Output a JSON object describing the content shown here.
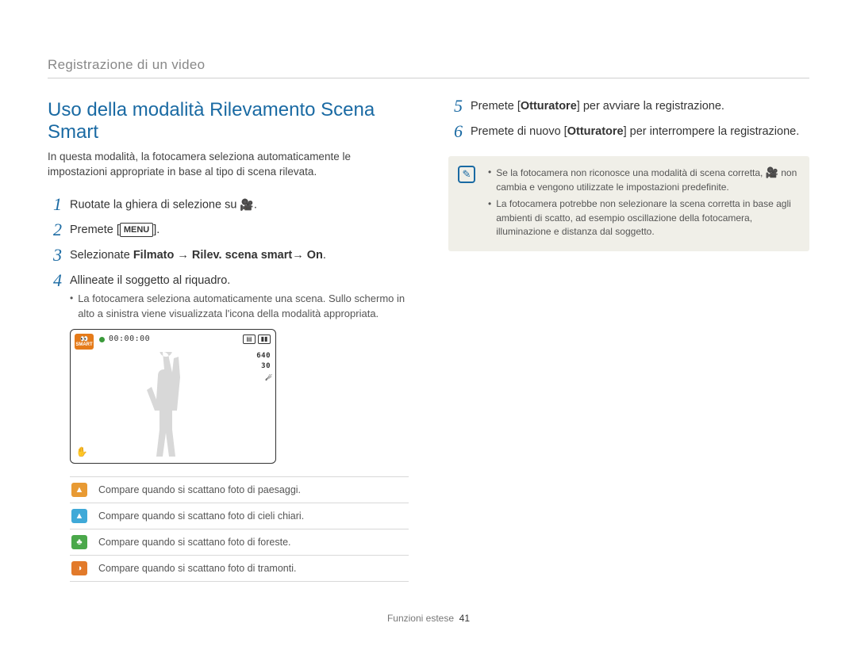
{
  "header": {
    "section": "Registrazione di un video"
  },
  "title": "Uso della modalità Rilevamento Scena Smart",
  "intro": "In questa modalità, la fotocamera seleziona automaticamente le impostazioni appropriate in base al tipo di scena rilevata.",
  "steps_left": [
    {
      "n": "1",
      "pre": "Ruotate la ghiera di selezione su ",
      "icon": "🎥",
      "post": "."
    },
    {
      "n": "2",
      "pre": "Premete [",
      "label": "MENU",
      "post": "]."
    },
    {
      "n": "3",
      "pre": "Selezionate ",
      "bold": "Filmato → Rilev. scena smart→ On",
      "post": "."
    },
    {
      "n": "4",
      "pre": "Allineate il soggetto al riquadro.",
      "sub": "La fotocamera seleziona automaticamente una scena. Sullo schermo in alto a sinistra viene visualizzata l'icona della modalità appropriata."
    }
  ],
  "preview": {
    "smart": "SMART",
    "time": "00:00:00",
    "res": "640",
    "fps": "30"
  },
  "scene_table": [
    {
      "color": "ic-orange",
      "glyph": "▲",
      "text": "Compare quando si scattano foto di paesaggi."
    },
    {
      "color": "ic-blue",
      "glyph": "▲",
      "text": "Compare quando si scattano foto di cieli chiari."
    },
    {
      "color": "ic-green",
      "glyph": "♣",
      "text": "Compare quando si scattano foto di foreste."
    },
    {
      "color": "ic-sunset",
      "glyph": "◑",
      "text": "Compare quando si scattano foto di tramonti."
    }
  ],
  "steps_right": [
    {
      "n": "5",
      "pre": "Premete [",
      "bold": "Otturatore",
      "post": "] per avviare la registrazione."
    },
    {
      "n": "6",
      "pre": "Premete di nuovo [",
      "bold": "Otturatore",
      "post": "] per interrompere la registrazione."
    }
  ],
  "notes": [
    {
      "pre": "Se la fotocamera non riconosce una modalità di scena corretta, ",
      "icon": "🎥",
      "post": " non cambia e vengono utilizzate le impostazioni predefinite."
    },
    {
      "full": "La fotocamera potrebbe non selezionare la scena corretta in base agli ambienti di scatto, ad esempio oscillazione della fotocamera, illuminazione e distanza dal soggetto."
    }
  ],
  "footer": {
    "label": "Funzioni estese",
    "page": "41"
  }
}
